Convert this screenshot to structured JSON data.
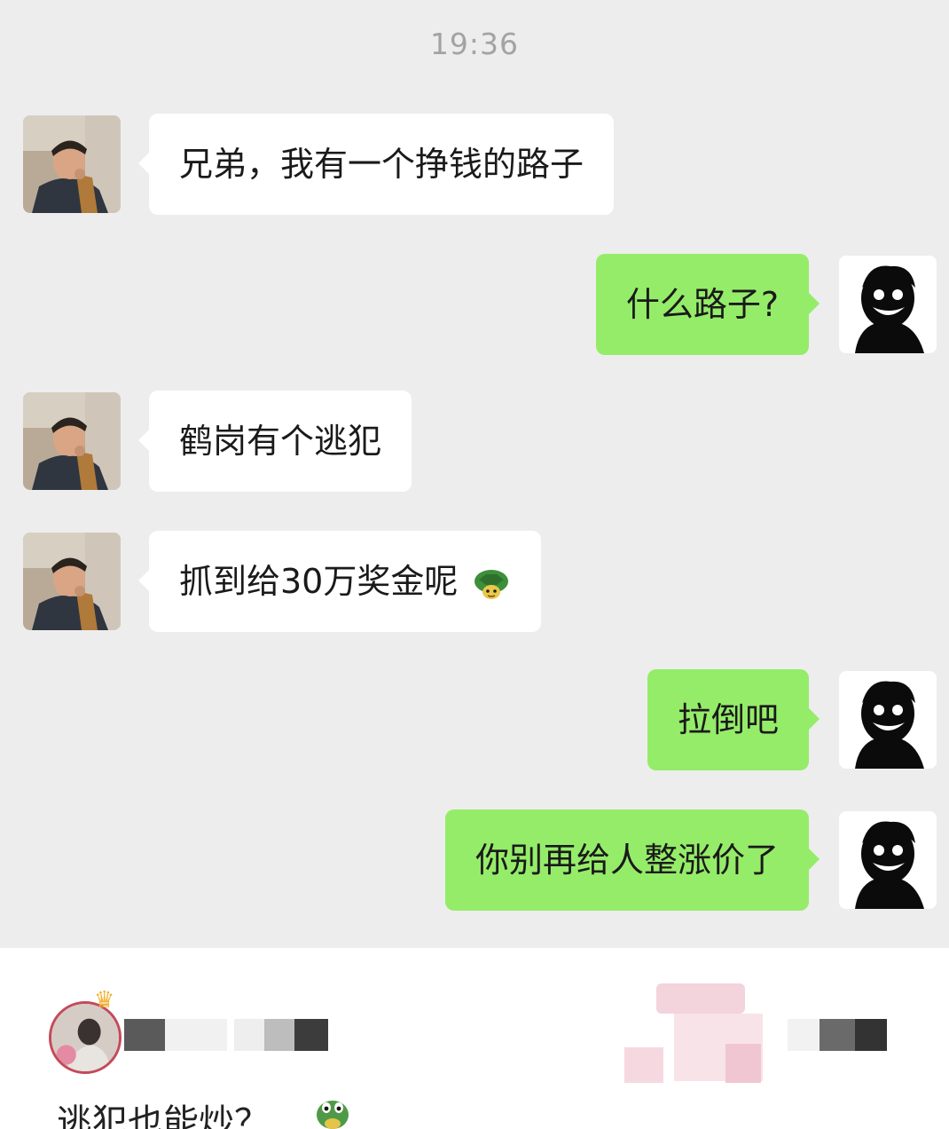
{
  "chat": {
    "time": "19:36",
    "messages": [
      {
        "side": "left",
        "sender": "friend",
        "text": "兄弟，我有一个挣钱的路子",
        "emoji": ""
      },
      {
        "side": "right",
        "sender": "me",
        "text": "什么路子?",
        "emoji": ""
      },
      {
        "side": "left",
        "sender": "friend",
        "text": "鹤岗有个逃犯",
        "emoji": ""
      },
      {
        "side": "left",
        "sender": "friend",
        "text": "抓到给30万奖金呢",
        "emoji": "turtle-emoji"
      },
      {
        "side": "right",
        "sender": "me",
        "text": "拉倒吧",
        "emoji": ""
      },
      {
        "side": "right",
        "sender": "me",
        "text": "你别再给人整涨价了",
        "emoji": ""
      }
    ]
  },
  "comment": {
    "text": "逃犯也能炒？",
    "emoji": "turtle-emoji",
    "badge_icon": "crown-icon"
  },
  "colors": {
    "chat_background": "#ededed",
    "incoming_bubble": "#ffffff",
    "outgoing_bubble": "#95ec69",
    "timestamp": "#a3a3a3"
  }
}
